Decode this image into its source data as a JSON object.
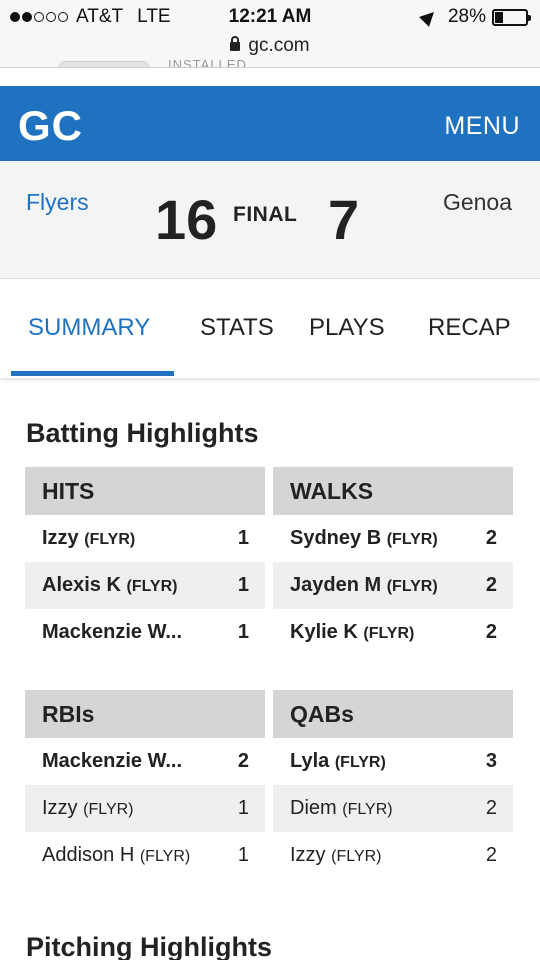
{
  "status_bar": {
    "carrier": "AT&T",
    "network": "LTE",
    "time": "12:21 AM",
    "battery": "28%",
    "battery_level": 0.28,
    "signal_bars_filled": 2,
    "signal_bars_total": 5
  },
  "url_bar": {
    "url": "gc.com",
    "peek_text": "INSTALLED"
  },
  "header": {
    "logo": "GC",
    "menu_label": "MENU",
    "bg_color": "#1f72c0"
  },
  "scoreboard": {
    "home_team": "Flyers",
    "home_score": "16",
    "status": "FINAL",
    "away_score": "7",
    "away_team": "Genoa"
  },
  "tabs": [
    {
      "label": "SUMMARY",
      "active": true
    },
    {
      "label": "STATS",
      "active": false
    },
    {
      "label": "PLAYS",
      "active": false
    },
    {
      "label": "RECAP",
      "active": false
    }
  ],
  "batting": {
    "title": "Batting Highlights",
    "hits": {
      "header": "HITS",
      "rows": [
        {
          "name": "Izzy",
          "team": "(FLYR)",
          "value": "1"
        },
        {
          "name": "Alexis K",
          "team": "(FLYR)",
          "value": "1"
        },
        {
          "name": "Mackenzie W...",
          "team": "",
          "value": "1"
        }
      ]
    },
    "walks": {
      "header": "WALKS",
      "rows": [
        {
          "name": "Sydney B",
          "team": "(FLYR)",
          "value": "2"
        },
        {
          "name": "Jayden M",
          "team": "(FLYR)",
          "value": "2"
        },
        {
          "name": "Kylie K",
          "team": "(FLYR)",
          "value": "2"
        }
      ]
    },
    "rbis": {
      "header": "RBIs",
      "rows": [
        {
          "name": "Mackenzie W...",
          "team": "",
          "value": "2"
        },
        {
          "name": "Izzy",
          "team": "(FLYR)",
          "value": "1"
        },
        {
          "name": "Addison H",
          "team": "(FLYR)",
          "value": "1"
        }
      ]
    },
    "qabs": {
      "header": "QABs",
      "rows": [
        {
          "name": "Lyla",
          "team": "(FLYR)",
          "value": "3"
        },
        {
          "name": "Diem",
          "team": "(FLYR)",
          "value": "2"
        },
        {
          "name": "Izzy",
          "team": "(FLYR)",
          "value": "2"
        }
      ]
    }
  },
  "pitching": {
    "title": "Pitching Highlights"
  }
}
